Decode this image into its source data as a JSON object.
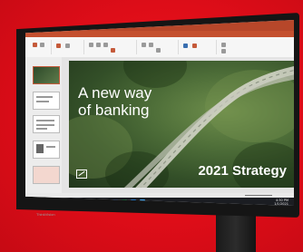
{
  "slide": {
    "headline_line1": "A new way",
    "headline_line2": "of banking",
    "subtitle": "2021 Strategy"
  },
  "taskbar": {
    "search_placeholder": "Type here to search",
    "time": "4:30 PM",
    "date": "1/1/2021"
  },
  "bezel": {
    "brand": "ThinkVision"
  },
  "colors": {
    "background": "#e30f1b",
    "ppt_accent": "#b7472a",
    "taskbar": "#1b1d22"
  }
}
